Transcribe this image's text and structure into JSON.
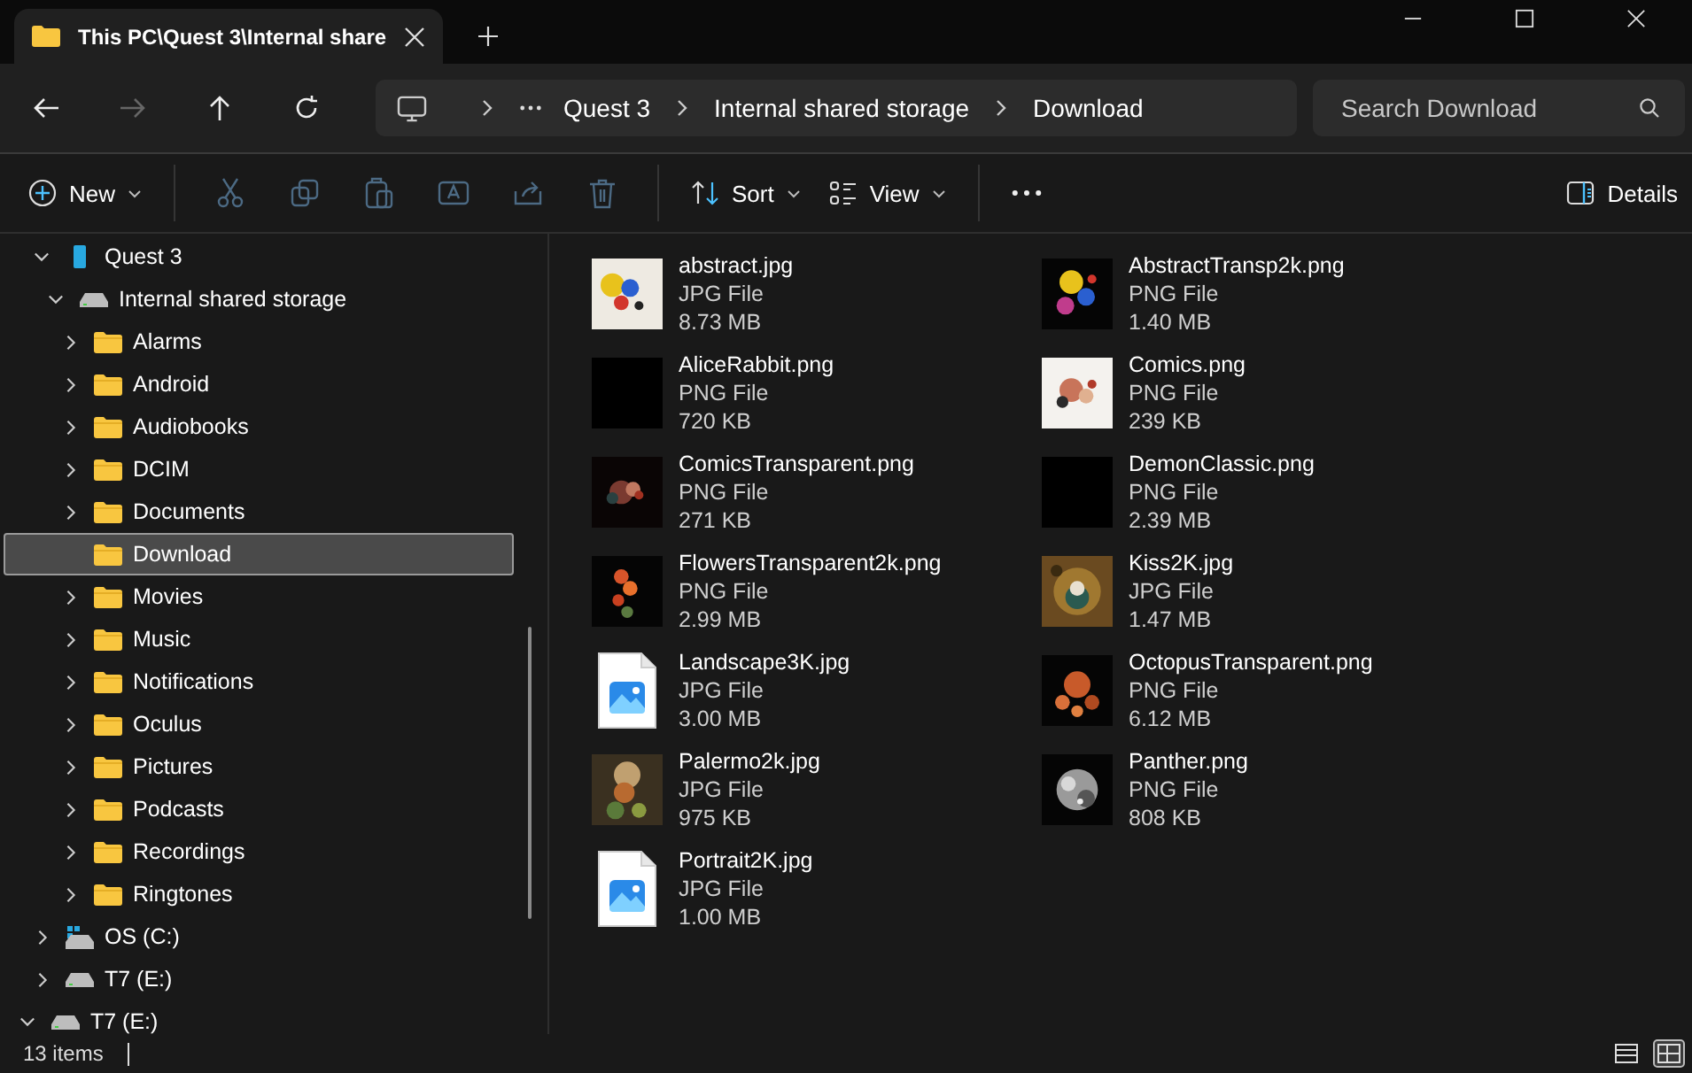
{
  "window": {
    "tab_title": "This PC\\Quest 3\\Internal share"
  },
  "nav": {
    "back_disabled": false,
    "forward_disabled": true,
    "breadcrumb": [
      "Quest 3",
      "Internal shared storage",
      "Download"
    ],
    "search": {
      "placeholder": "Search Download"
    }
  },
  "toolbar": {
    "new_label": "New",
    "actions": [
      {
        "kind": "cut",
        "disabled": true
      },
      {
        "kind": "copy",
        "disabled": true
      },
      {
        "kind": "paste",
        "disabled": true
      },
      {
        "kind": "rename",
        "disabled": true
      },
      {
        "kind": "share",
        "disabled": true
      },
      {
        "kind": "delete",
        "disabled": true
      }
    ],
    "sort_label": "Sort",
    "view_label": "View",
    "details_label": "Details"
  },
  "sidebar": {
    "this_pc_children": [
      {
        "label": "Quest 3",
        "kind": "phone",
        "expanded": true,
        "selected": false,
        "children": [
          {
            "label": "Internal shared storage",
            "kind": "drive",
            "expanded": true,
            "selected": false,
            "children": [
              {
                "label": "Alarms",
                "kind": "folder",
                "expanded": false,
                "selected": false
              },
              {
                "label": "Android",
                "kind": "folder",
                "expanded": false,
                "selected": false
              },
              {
                "label": "Audiobooks",
                "kind": "folder",
                "expanded": false,
                "selected": false
              },
              {
                "label": "DCIM",
                "kind": "folder",
                "expanded": false,
                "selected": false
              },
              {
                "label": "Documents",
                "kind": "folder",
                "expanded": false,
                "selected": false
              },
              {
                "label": "Download",
                "kind": "folder",
                "selected": true
              },
              {
                "label": "Movies",
                "kind": "folder",
                "expanded": false,
                "selected": false
              },
              {
                "label": "Music",
                "kind": "folder",
                "expanded": false,
                "selected": false
              },
              {
                "label": "Notifications",
                "kind": "folder",
                "expanded": false,
                "selected": false
              },
              {
                "label": "Oculus",
                "kind": "folder",
                "expanded": false,
                "selected": false
              },
              {
                "label": "Pictures",
                "kind": "folder",
                "expanded": false,
                "selected": false
              },
              {
                "label": "Podcasts",
                "kind": "folder",
                "expanded": false,
                "selected": false
              },
              {
                "label": "Recordings",
                "kind": "folder",
                "expanded": false,
                "selected": false
              },
              {
                "label": "Ringtones",
                "kind": "folder",
                "expanded": false,
                "selected": false
              }
            ]
          }
        ]
      },
      {
        "label": "OS (C:)",
        "kind": "os-drive",
        "expanded": false,
        "selected": false
      },
      {
        "label": "T7 (E:)",
        "kind": "drive",
        "expanded": false,
        "selected": false
      }
    ],
    "items": [
      {
        "label": "T7 (E:)",
        "kind": "drive",
        "expanded": true,
        "selected": false
      }
    ]
  },
  "files": [
    {
      "name": "abstract.jpg",
      "type": "JPG File",
      "size": "8.73 MB",
      "kind": "picture"
    },
    {
      "name": "AbstractTransp2k.png",
      "type": "PNG File",
      "size": "1.40 MB",
      "kind": "picture"
    },
    {
      "name": "AliceRabbit.png",
      "type": "PNG File",
      "size": "720 KB",
      "kind": "picture"
    },
    {
      "name": "Comics.png",
      "type": "PNG File",
      "size": "239 KB",
      "kind": "picture"
    },
    {
      "name": "ComicsTransparent.png",
      "type": "PNG File",
      "size": "271 KB",
      "kind": "picture"
    },
    {
      "name": "DemonClassic.png",
      "type": "PNG File",
      "size": "2.39 MB",
      "kind": "picture"
    },
    {
      "name": "FlowersTransparent2k.png",
      "type": "PNG File",
      "size": "2.99 MB",
      "kind": "picture"
    },
    {
      "name": "Kiss2K.jpg",
      "type": "JPG File",
      "size": "1.47 MB",
      "kind": "picture"
    },
    {
      "name": "Landscape3K.jpg",
      "type": "JPG File",
      "size": "3.00 MB",
      "kind": "file-icon"
    },
    {
      "name": "OctopusTransparent.png",
      "type": "PNG File",
      "size": "6.12 MB",
      "kind": "picture"
    },
    {
      "name": "Palermo2k.jpg",
      "type": "JPG File",
      "size": "975 KB",
      "kind": "picture"
    },
    {
      "name": "Panther.png",
      "type": "PNG File",
      "size": "808 KB",
      "kind": "picture"
    },
    {
      "name": "Portrait2K.jpg",
      "type": "JPG File",
      "size": "1.00 MB",
      "kind": "file-icon"
    }
  ],
  "status_bar": {
    "count": "13 items",
    "views": [
      {
        "kind": "details",
        "selected": false
      },
      {
        "kind": "tiles",
        "selected": true
      }
    ]
  }
}
